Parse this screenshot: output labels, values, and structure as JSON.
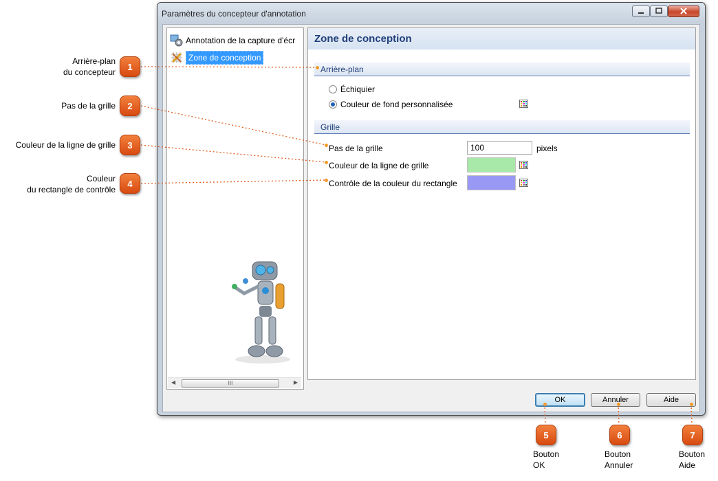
{
  "window": {
    "title": "Paramètres du concepteur d'annotation"
  },
  "tree": {
    "items": [
      {
        "label": "Annotation de la capture d'écr",
        "icon": "gear-capture-icon"
      },
      {
        "label": "Zone de conception",
        "icon": "design-area-icon",
        "selected": true
      }
    ],
    "scrollbar_thumb": "III"
  },
  "panel": {
    "title": "Zone de conception",
    "background_section": {
      "title": "Arrière-plan",
      "options": [
        {
          "label": "Échiquier",
          "selected": false
        },
        {
          "label": "Couleur de fond personnalisée",
          "selected": true
        }
      ]
    },
    "grid_section": {
      "title": "Grille",
      "grid_step_label": "Pas de la grille",
      "grid_step_value": "100",
      "grid_step_unit": "pixels",
      "grid_line_color_label": "Couleur de la ligne de grille",
      "grid_line_color": "#a8e8a8",
      "control_rect_color_label": "Contrôle de la couleur du rectangle",
      "control_rect_color": "#9999f5"
    }
  },
  "buttons": {
    "ok": "OK",
    "cancel": "Annuler",
    "help": "Aide"
  },
  "callouts": [
    {
      "number": "1",
      "line1": "Arrière-plan",
      "line2": "du concepteur"
    },
    {
      "number": "2",
      "line1": "Pas de la grille"
    },
    {
      "number": "3",
      "line1": "Couleur de la ligne de grille"
    },
    {
      "number": "4",
      "line1": "Couleur",
      "line2": "du rectangle de contrôle"
    },
    {
      "number": "5",
      "line1": "Bouton",
      "line2": "OK"
    },
    {
      "number": "6",
      "line1": "Bouton",
      "line2": "Annuler"
    },
    {
      "number": "7",
      "line1": "Bouton",
      "line2": "Aide"
    }
  ],
  "colors": {
    "accent": "#1f3f79",
    "callout": "#e25f1e",
    "selection": "#3399ff"
  }
}
